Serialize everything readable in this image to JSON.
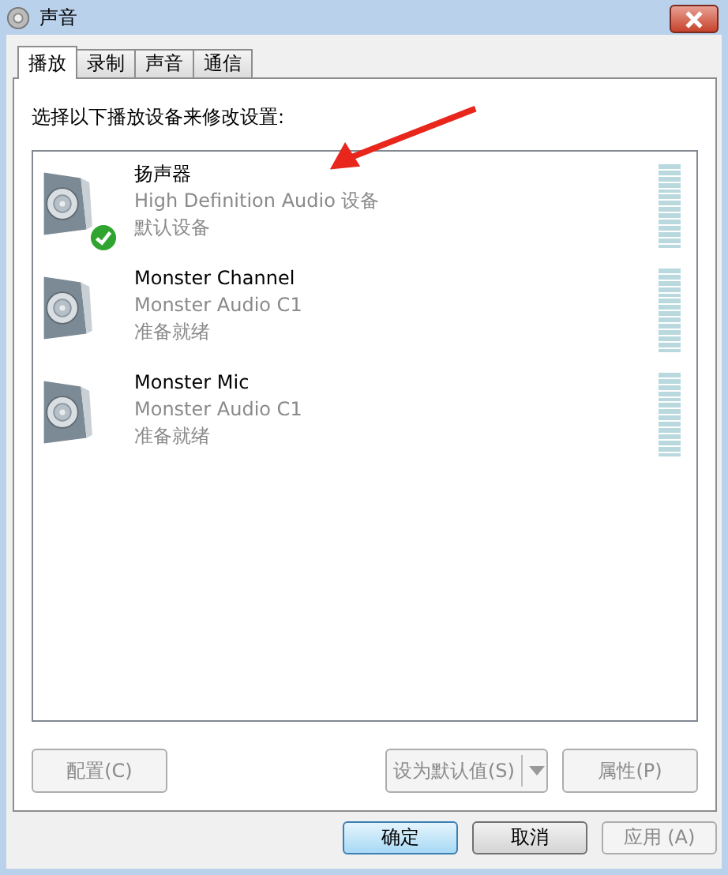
{
  "window": {
    "title": "声音"
  },
  "tabs": [
    {
      "label": "播放",
      "selected": true
    },
    {
      "label": "录制",
      "selected": false
    },
    {
      "label": "声音",
      "selected": false
    },
    {
      "label": "通信",
      "selected": false
    }
  ],
  "instruction": "选择以下播放设备来修改设置:",
  "devices": [
    {
      "name": "扬声器",
      "driver": "High Definition Audio 设备",
      "status": "默认设备",
      "default": true
    },
    {
      "name": "Monster Channel",
      "driver": "Monster Audio C1",
      "status": "准备就绪",
      "default": false
    },
    {
      "name": "Monster Mic",
      "driver": "Monster Audio C1",
      "status": "准备就绪",
      "default": false
    }
  ],
  "panel_buttons": {
    "configure": {
      "label": "配置(C)",
      "disabled": true
    },
    "set_default": {
      "label": "设为默认值(S)",
      "disabled": true
    },
    "properties": {
      "label": "属性(P)",
      "disabled": true
    }
  },
  "dialog_buttons": [
    {
      "label": "确定",
      "disabled": false,
      "default": true
    },
    {
      "label": "取消",
      "disabled": false,
      "default": false
    },
    {
      "label": "应用 (A)",
      "disabled": true,
      "default": false
    }
  ]
}
